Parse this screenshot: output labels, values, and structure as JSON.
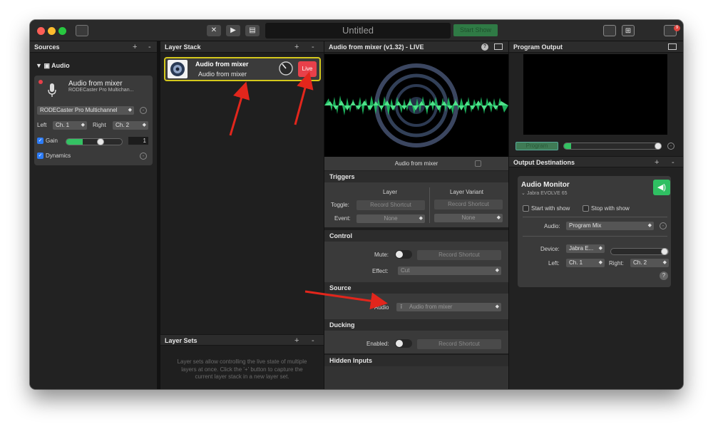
{
  "window": {
    "title": "Untitled",
    "go_live_label": "Start Show",
    "notification_count": "9",
    "toolbar_icons": [
      "sidebar-toggle-icon",
      "crossfade-icon",
      "transition-icon",
      "clapper-icon",
      "layout-single-icon",
      "layout-multi-icon",
      "notifications-icon"
    ]
  },
  "sources": {
    "header": "Sources",
    "group_label": "Audio",
    "item_name": "Audio from mixer",
    "item_device": "RODECaster Pro Multichan...",
    "device_select": "RODECaster Pro Multichannel",
    "left_label": "Left",
    "left_value": "Ch. 1",
    "right_label": "Right",
    "right_value": "Ch. 2",
    "gain_label": "Gain",
    "gain_value": "1",
    "gain_level": 0.3,
    "dynamics_label": "Dynamics"
  },
  "layer_stack": {
    "header": "Layer Stack",
    "layer_title": "Audio from mixer",
    "layer_subtitle": "Audio from mixer",
    "live_label": "Live"
  },
  "layer_sets": {
    "header": "Layer Sets",
    "help_text": "Layer sets allow controlling the live state of multiple layers at once. Click the '+' button to capture the current layer stack in a new layer set."
  },
  "preview": {
    "header": "Audio from mixer (v1.32) - LIVE",
    "caption": "Audio from mixer"
  },
  "triggers": {
    "header": "Triggers",
    "col_layer": "Layer",
    "col_variant": "Layer Variant",
    "toggle_label": "Toggle:",
    "record_shortcut": "Record Shortcut",
    "event_label": "Event:",
    "none_label": "None"
  },
  "control": {
    "header": "Control",
    "mute_label": "Mute:",
    "effect_label": "Effect:",
    "effect_value": "Cut",
    "record_shortcut": "Record Shortcut"
  },
  "source_section": {
    "header": "Source",
    "audio_label": "Audio",
    "audio_value": "Audio from mixer"
  },
  "ducking": {
    "header": "Ducking",
    "enabled_label": "Enabled:",
    "record_shortcut": "Record Shortcut"
  },
  "hidden_inputs": {
    "header": "Hidden Inputs"
  },
  "program_output": {
    "header": "Program Output",
    "program_label": "Program",
    "level": 0.07
  },
  "output_destinations": {
    "header": "Output Destinations",
    "monitor_title": "Audio Monitor",
    "monitor_device": "Jabra EVOLVE 65",
    "start_with_show": "Start with show",
    "stop_with_show": "Stop with show",
    "audio_label": "Audio:",
    "audio_value": "Program Mix",
    "device_label": "Device:",
    "device_value": "Jabra E...",
    "left_label": "Left:",
    "left_value": "Ch. 1",
    "right_label": "Right:",
    "right_value": "Ch. 2",
    "help_label": "?"
  },
  "colors": {
    "accent_green": "#2fbf62",
    "live_red": "#e8404a",
    "selection_yellow": "#d4c81c",
    "annotation_red": "#e2261c"
  }
}
